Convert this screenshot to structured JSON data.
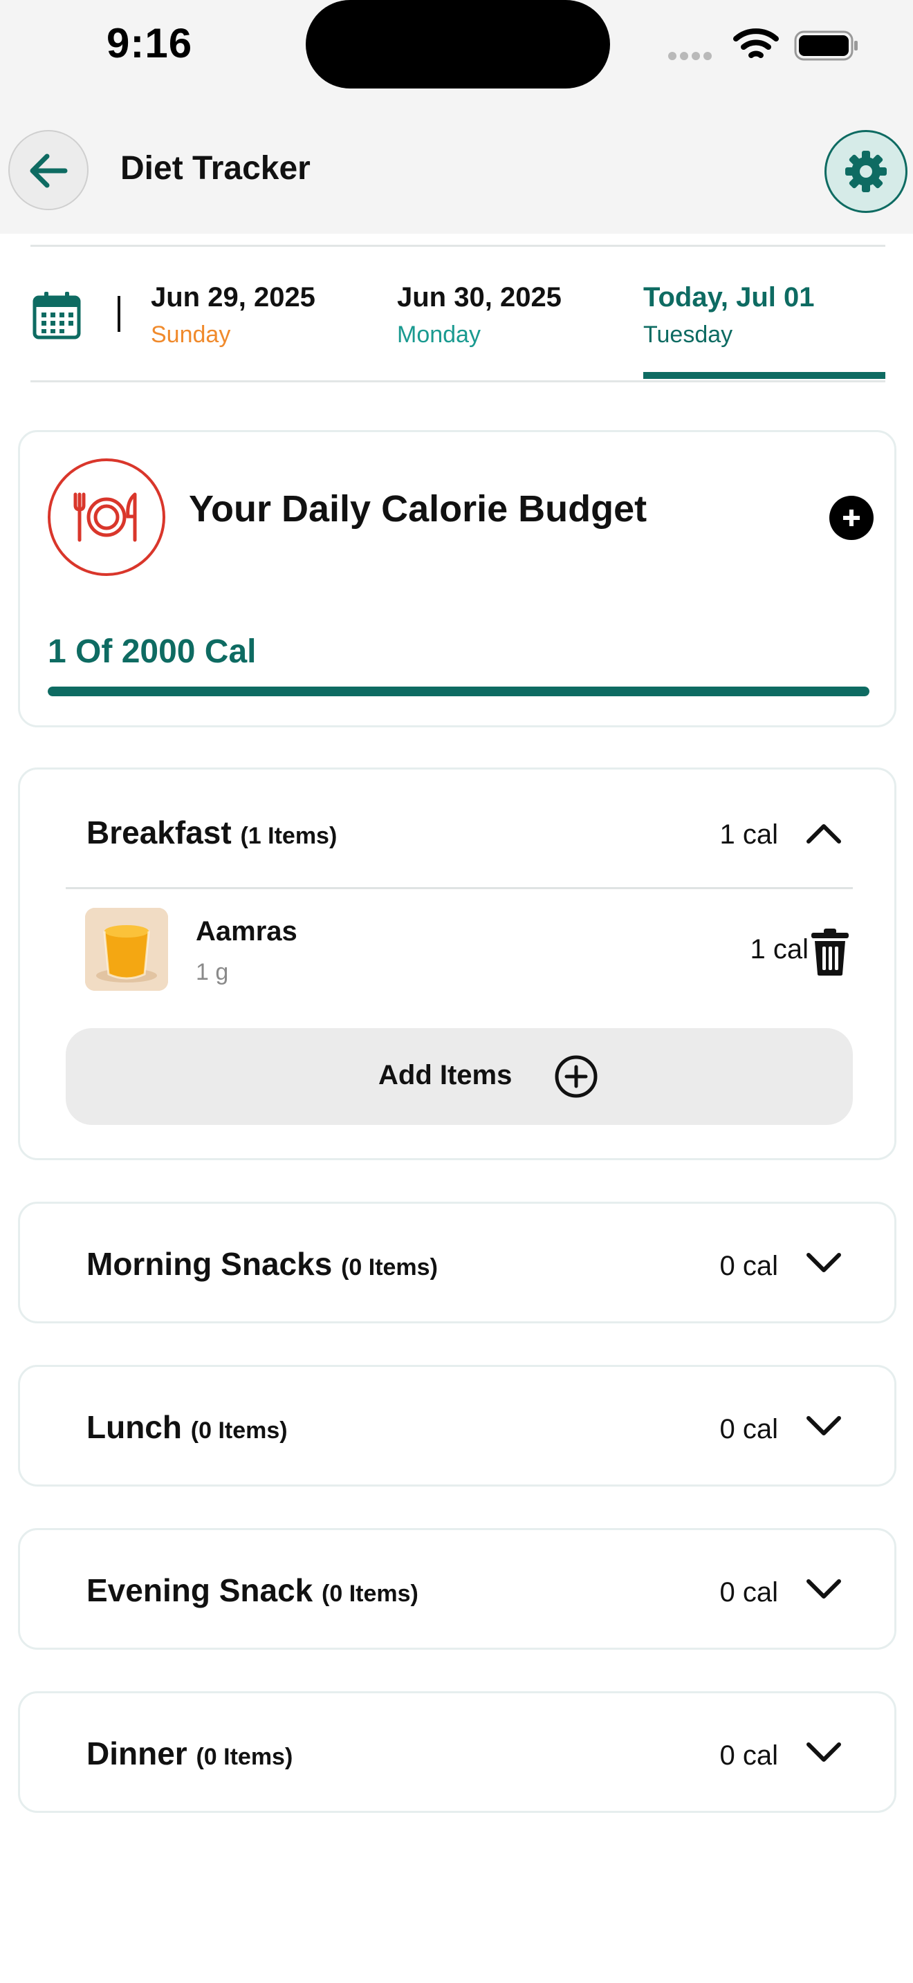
{
  "status_bar": {
    "time": "9:16"
  },
  "header": {
    "title": "Diet Tracker"
  },
  "date_strip": {
    "dates": [
      {
        "date": "Jun 29, 2025",
        "day": "Sunday",
        "day_color": "#f08a2c"
      },
      {
        "date": "Jun 30, 2025",
        "day": "Monday",
        "day_color": "#1a9a90"
      },
      {
        "date": "Today, Jul 01",
        "day": "Tuesday",
        "day_color": "#0e6b62",
        "active": true
      }
    ]
  },
  "budget": {
    "title": "Your Daily Calorie Budget",
    "summary": "1 Of 2000 Cal",
    "progress_fraction": 1.0
  },
  "meals": [
    {
      "name": "Breakfast",
      "count": "(1 Items)",
      "calories": "1 cal",
      "expanded": true,
      "items": [
        {
          "name": "Aamras",
          "quantity": "1 g",
          "calories": "1 cal"
        }
      ],
      "add_label": "Add Items"
    },
    {
      "name": "Morning Snacks",
      "count": "(0 Items)",
      "calories": "0 cal",
      "expanded": false
    },
    {
      "name": "Lunch",
      "count": "(0 Items)",
      "calories": "0 cal",
      "expanded": false
    },
    {
      "name": "Evening Snack",
      "count": "(0 Items)",
      "calories": "0 cal",
      "expanded": false
    },
    {
      "name": "Dinner",
      "count": "(0 Items)",
      "calories": "0 cal",
      "expanded": false
    }
  ],
  "colors": {
    "accent": "#0e6b62",
    "plate_icon": "#d9362b"
  },
  "icons": [
    "back-arrow-icon",
    "gear-icon",
    "calendar-icon",
    "plate-cutlery-icon",
    "plus-icon",
    "chevron-up-icon",
    "chevron-down-icon",
    "trash-icon",
    "plus-circle-icon"
  ]
}
